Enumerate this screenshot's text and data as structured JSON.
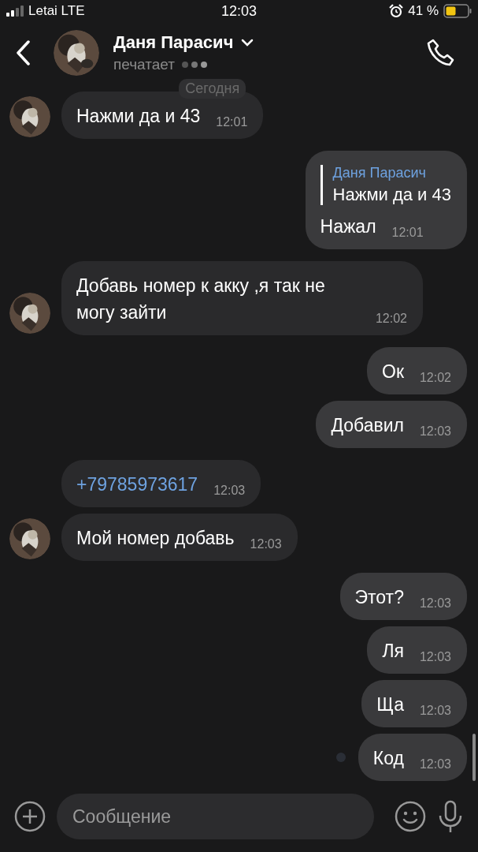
{
  "status_bar": {
    "carrier": "Letai LTE",
    "time": "12:03",
    "battery": "41 %"
  },
  "header": {
    "name": "Даня Парасич",
    "status": "печатает"
  },
  "date_badge": "Сегодня",
  "messages": [
    {
      "kind": "text",
      "outgoing": false,
      "avatar": true,
      "text": "Нажми да и 43",
      "time": "12:01",
      "unread": false
    },
    {
      "kind": "reply",
      "outgoing": true,
      "avatar": false,
      "quote_author": "Даня Парасич",
      "quote_text": "Нажми да и 43",
      "text": "Нажал",
      "time": "12:01",
      "unread": false
    },
    {
      "kind": "text",
      "outgoing": false,
      "avatar": true,
      "text": "Добавь номер к акку ,я так не могу зайти",
      "time": "12:02",
      "unread": false
    },
    {
      "kind": "text",
      "outgoing": true,
      "avatar": false,
      "text": "Ок",
      "time": "12:02",
      "unread": false
    },
    {
      "kind": "text",
      "outgoing": true,
      "avatar": false,
      "text": "Добавил",
      "time": "12:03",
      "unread": false
    },
    {
      "kind": "link",
      "outgoing": false,
      "avatar": false,
      "text": "+79785973617",
      "time": "12:03",
      "unread": false
    },
    {
      "kind": "text",
      "outgoing": false,
      "avatar": true,
      "text": "Мой номер добавь",
      "time": "12:03",
      "unread": false
    },
    {
      "kind": "text",
      "outgoing": true,
      "avatar": false,
      "text": "Этот?",
      "time": "12:03",
      "unread": false
    },
    {
      "kind": "text",
      "outgoing": true,
      "avatar": false,
      "text": "Ля",
      "time": "12:03",
      "unread": false
    },
    {
      "kind": "text",
      "outgoing": true,
      "avatar": false,
      "text": "Ща",
      "time": "12:03",
      "unread": false
    },
    {
      "kind": "text",
      "outgoing": true,
      "avatar": false,
      "text": "Код",
      "time": "12:03",
      "unread": true
    }
  ],
  "composer": {
    "placeholder": "Сообщение"
  }
}
